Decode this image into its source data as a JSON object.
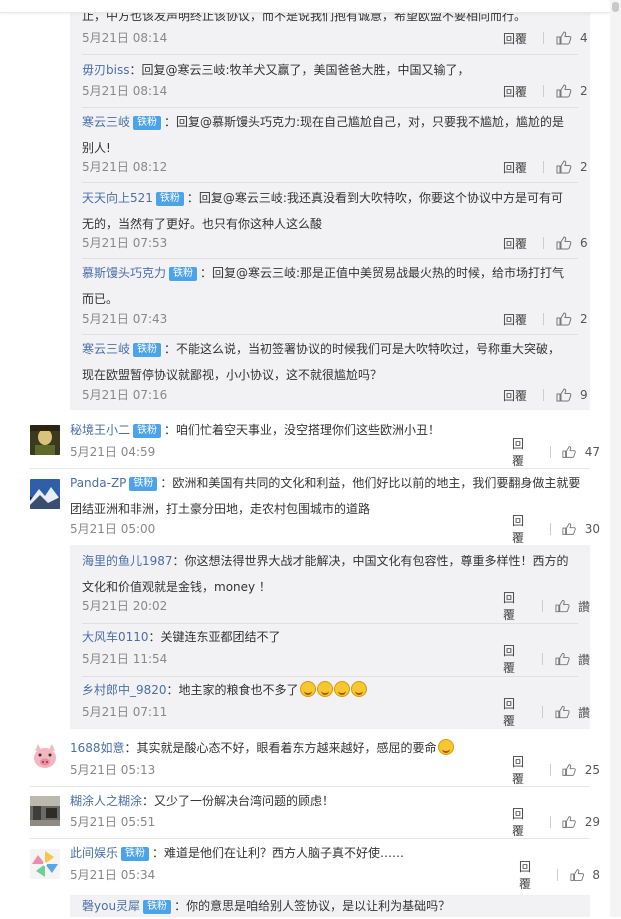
{
  "colors": {
    "username": "#4a6fa5",
    "fan_badge": "#4ca3e8",
    "nested_bg": "#f2f2f5"
  },
  "fan_badge_label": "铁粉",
  "reply_label": "回覆",
  "nested_top": {
    "items": [
      {
        "text": "止，中方也该发声明终止该协议，而不是说我们抱有诚意，希望欧盟不要相向而行。",
        "time": "5月21日 08:14",
        "likes": "4"
      },
      {
        "user": "毋刃biss",
        "text": "：回复@寒云三岐:牧羊犬又赢了，美国爸爸大胜，中国又输了，",
        "time": "5月21日 08:14",
        "likes": "2"
      },
      {
        "user": "寒云三岐",
        "text": "：回复@慕斯馒头巧克力:现在自己尴尬自己，对，只要我不尴尬，尴尬的是别人!",
        "time": "5月21日 08:12",
        "likes": "2"
      },
      {
        "user": "天天向上521",
        "text": "：回复@寒云三岐:我还真没看到大吹特吹，你要这个协议中方是可有可无的，当然有了更好。也只有你这种人这么酸",
        "time": "5月21日 07:53",
        "likes": "6"
      },
      {
        "user": "慕斯馒头巧克力",
        "text": "：回复@寒云三岐:那是正值中美贸易战最火热的时候，给市场打打气而已。",
        "time": "5月21日 07:43",
        "likes": "2"
      },
      {
        "user": "寒云三岐",
        "text": "：不能这么说，当初签署协议的时候我们可是大吹特吹过，号称重大突破，现在欧盟暂停协议就鄙视，小小协议，这不就很尴尬吗？",
        "time": "5月21日 07:16",
        "likes": "9"
      }
    ]
  },
  "comments": [
    {
      "user": "秘境王小二",
      "text": "：咱们忙着空天事业，没空搭理你们这些欧洲小丑！",
      "time": "5月21日 04:59",
      "likes": "47",
      "avatar": "dark-portrait-avatar"
    },
    {
      "user": "Panda-ZP",
      "text": "：欧洲和美国有共同的文化和利益，他们好比以前的地主，我们要翻身做主就要团结亚洲和非洲，打土豪分田地，走农村包围城市的道路",
      "time": "5月21日 05:00",
      "likes": "30",
      "avatar": "mountain-avatar"
    },
    {
      "user": "1688如意",
      "text": "：其实就是酸心态不好，眼看着东方越来越好，感屈的要命",
      "time": "5月21日 05:13",
      "likes": "25",
      "avatar": "pig-avatar"
    },
    {
      "user": "糊涂人之糊涂",
      "text": "：又少了一份解决台湾问题的顾虑！",
      "time": "5月21日 05:51",
      "likes": "29",
      "avatar": "street-avatar"
    },
    {
      "user": "此间娱乐",
      "text": "：难道是他们在让利？西方人脑子真不好使……",
      "time": "5月21日 05:34",
      "likes": "8",
      "avatar": "pinwheel-avatar"
    }
  ],
  "nested_panda": {
    "items": [
      {
        "user": "海里的鱼儿1987",
        "text": "：你这想法得世界大战才能解决，中国文化有包容性，尊重多样性！西方的文化和价值观就是金钱，money ！",
        "time": "5月21日 20:02",
        "likes": "讚"
      },
      {
        "user": "大风车0110",
        "text": "：关键连东亚都团结不了",
        "time": "5月21日 11:54",
        "likes": "讚"
      },
      {
        "user": "乡村郎中_9820",
        "text": "：地主家的粮食也不多了",
        "time": "5月21日 07:11",
        "likes": "讚"
      }
    ]
  },
  "nested_last": {
    "user": "磬you灵犀",
    "text": "：你的意思是咱给别人签协议，是以让利为基础吗？"
  }
}
